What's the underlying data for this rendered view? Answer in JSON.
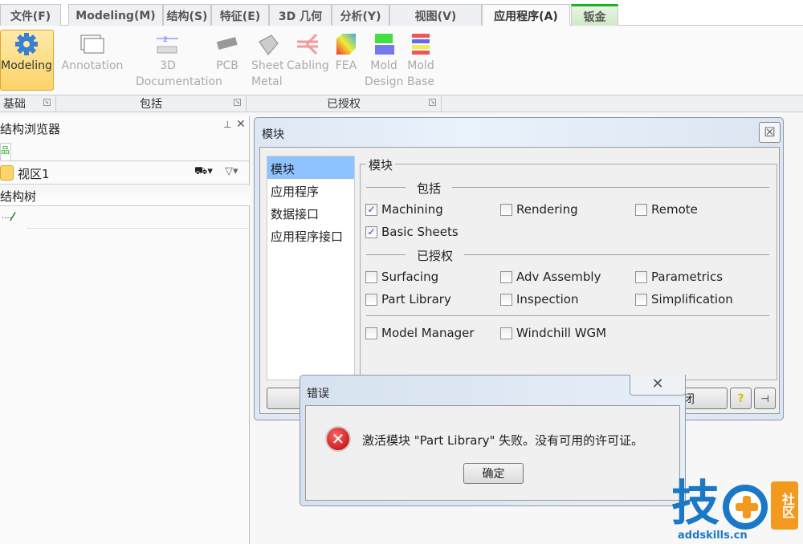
{
  "tabs": [
    "文件(F)",
    "Modeling(M)",
    "结构(S)",
    "特征(E)",
    "3D 几何",
    "分析(Y)",
    "视图(V)",
    "应用程序(A)",
    "钣金"
  ],
  "active_tab": "应用程序(A)",
  "ribbon": {
    "buttons": [
      {
        "label": "Modeling",
        "icon": "gear-icon"
      },
      {
        "label": "Annotation",
        "icon": "annotation-icon"
      },
      {
        "label": "3D Documentation",
        "icon": "dimension-icon"
      },
      {
        "label": "PCB",
        "icon": "chip-icon"
      },
      {
        "label": "Sheet Metal",
        "icon": "sheet-metal-icon"
      },
      {
        "label": "Cabling",
        "icon": "cabling-icon"
      },
      {
        "label": "FEA",
        "icon": "fea-icon"
      },
      {
        "label": "Mold Design",
        "icon": "mold-design-icon"
      },
      {
        "label": "Mold Base",
        "icon": "mold-base-icon"
      }
    ],
    "groups": [
      "基础",
      "包括",
      "已授权"
    ]
  },
  "browser": {
    "title": "结构浏览器",
    "view": "视区1",
    "tree_header": "结构树"
  },
  "modules_dialog": {
    "title": "模块",
    "nav": [
      "模块",
      "应用程序",
      "数据接口",
      "应用程序接口"
    ],
    "group_title": "模块",
    "included_label": "包括",
    "licensed_label": "已授权",
    "included": [
      {
        "label": "Machining",
        "checked": true
      },
      {
        "label": "Rendering",
        "checked": false
      },
      {
        "label": "Remote",
        "checked": false
      },
      {
        "label": "Basic Sheets",
        "checked": true
      }
    ],
    "licensed": [
      {
        "label": "Surfacing",
        "checked": false
      },
      {
        "label": "Adv Assembly",
        "checked": false
      },
      {
        "label": "Parametrics",
        "checked": false
      },
      {
        "label": "Part Library",
        "checked": false
      },
      {
        "label": "Inspection",
        "checked": false
      },
      {
        "label": "Simplification",
        "checked": false
      }
    ],
    "other": [
      {
        "label": "Model Manager",
        "checked": false
      },
      {
        "label": "Windchill WGM",
        "checked": false
      }
    ],
    "close_label": "关闭"
  },
  "error_dialog": {
    "title": "错误",
    "message": "激活模块 \"Part Library\" 失败。没有可用的许可证。",
    "ok_label": "确定"
  },
  "watermark": {
    "text": "技",
    "sub": "社区",
    "url": "addskills.cn"
  },
  "colors": {
    "accent_green": "#22b022",
    "selected_nav": "#8ec3ff",
    "modeling_highlight": "#fbd46a"
  }
}
